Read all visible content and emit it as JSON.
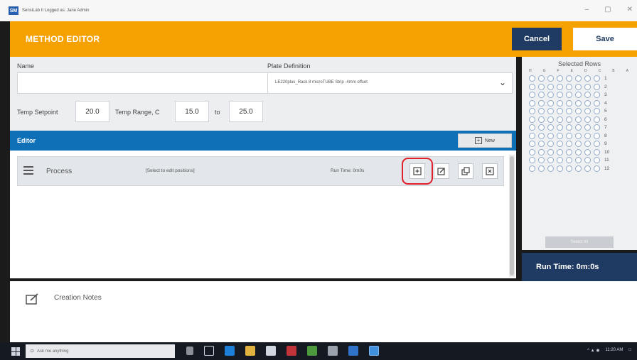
{
  "window": {
    "app_logo": "SM",
    "title": "SensiLab II Logged as: Jane Admin",
    "controls": {
      "minimize": "–",
      "maximize": "▢",
      "close": "✕"
    }
  },
  "header": {
    "title": "METHOD EDITOR",
    "cancel_label": "Cancel",
    "save_label": "Save",
    "accent_color": "#f5a100",
    "nav_color": "#1f3b63"
  },
  "form": {
    "name_label": "Name",
    "name_value": "",
    "plate_label": "Plate Definition",
    "plate_value": "LE220plus_Rack 8 microTUBE Strip -4mm offset",
    "temp_setpoint_label": "Temp Setpoint",
    "temp_setpoint_value": "20.0",
    "temp_range_label": "Temp Range, C",
    "temp_range_from": "15.0",
    "temp_range_to_label": "to",
    "temp_range_to": "25.0"
  },
  "editor": {
    "title": "Editor",
    "new_label": "New",
    "bar_color": "#0f6fb7",
    "process": {
      "label": "Process",
      "hint": "[Select to edit positions]",
      "run_time": "Run Time: 0m0s",
      "actions": [
        "add-step-icon",
        "edit-icon",
        "copy-icon",
        "delete-icon"
      ],
      "highlight_color": "#e0202a"
    }
  },
  "selected_rows": {
    "title": "Selected Rows",
    "columns": [
      "H",
      "G",
      "F",
      "E",
      "D",
      "C",
      "B",
      "A"
    ],
    "rows": [
      "1",
      "2",
      "3",
      "4",
      "5",
      "6",
      "7",
      "8",
      "9",
      "10",
      "11",
      "12"
    ],
    "select_all_label": "Select All"
  },
  "run_time_total": "Run Time: 0m:0s",
  "notes": {
    "label": "Creation Notes"
  },
  "taskbar": {
    "search_placeholder": "Ask me anything",
    "clock": "11:20 AM"
  }
}
